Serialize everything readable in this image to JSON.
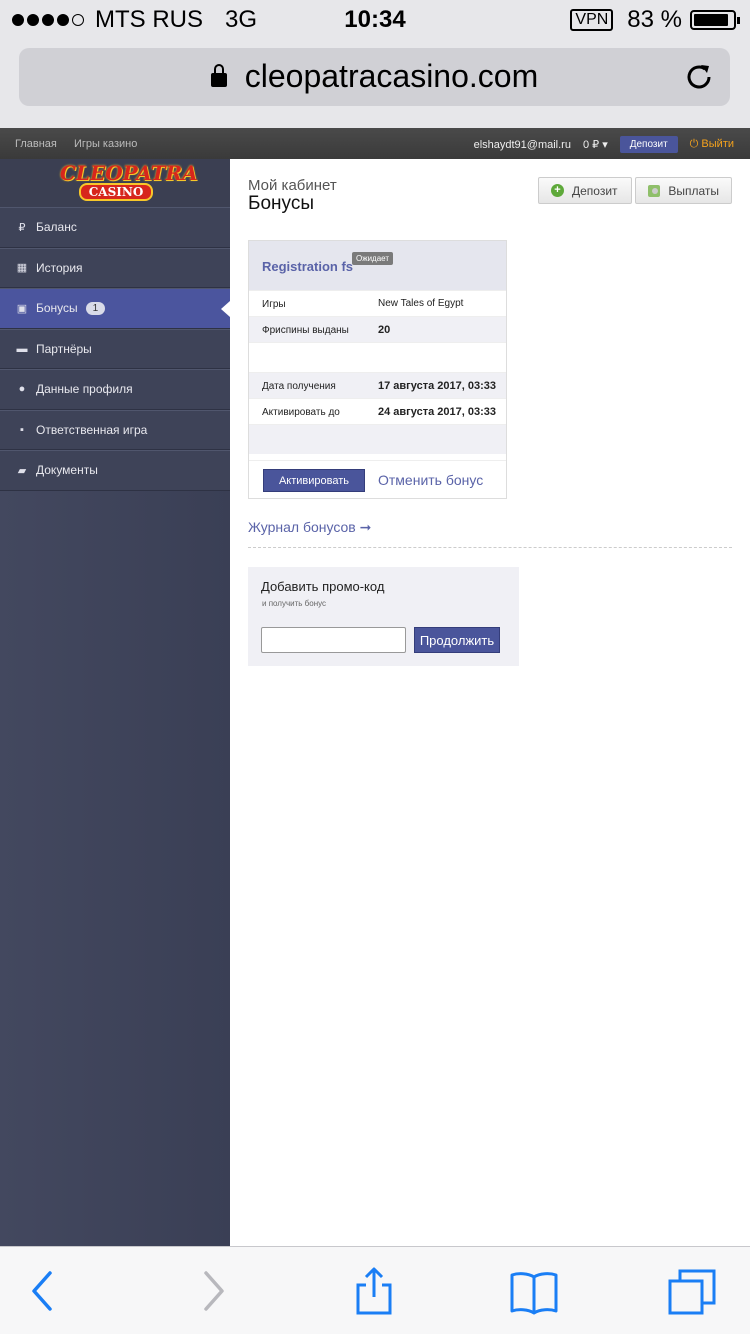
{
  "status_bar": {
    "carrier": "MTS RUS",
    "network": "3G",
    "time": "10:34",
    "vpn": "VPN",
    "battery": "83 %"
  },
  "browser": {
    "url": "cleopatracasino.com",
    "icons": [
      "lock-icon",
      "reload-icon",
      "back-icon",
      "forward-icon",
      "share-icon",
      "bookmarks-icon",
      "tabs-icon"
    ]
  },
  "topbar": {
    "nav": [
      "Главная",
      "Игры казино"
    ],
    "email": "elshaydt91@mail.ru",
    "balance": "0 ₽ ▾",
    "deposit": "Депозит",
    "exit": "⏻ Выйти"
  },
  "logo": {
    "line1": "CLEOPATRA",
    "line2": "CASINO"
  },
  "sidebar": {
    "items": [
      {
        "label": "Баланс",
        "icon": "ruble-icon",
        "glyph": "₽"
      },
      {
        "label": "История",
        "icon": "calendar-icon",
        "glyph": "▦"
      },
      {
        "label": "Бонусы",
        "icon": "gift-icon",
        "glyph": "▣",
        "badge": "1"
      },
      {
        "label": "Партнёры",
        "icon": "briefcase-icon",
        "glyph": "▬"
      },
      {
        "label": "Данные профиля",
        "icon": "info-icon",
        "glyph": "●"
      },
      {
        "label": "Ответственная игра",
        "icon": "lock-icon",
        "glyph": "▪"
      },
      {
        "label": "Документы",
        "icon": "folder-icon",
        "glyph": "▰"
      }
    ]
  },
  "main": {
    "breadcrumb": "Мой кабинет",
    "title": "Бонусы",
    "deposit_button": "Депозит",
    "payouts_button": "Выплаты",
    "bonus": {
      "title": "Registration fs",
      "status": "Ожидает",
      "rows": [
        {
          "key": "Игры",
          "value": "New Tales of Egypt"
        },
        {
          "key": "Фриспины выданы",
          "value": "20"
        },
        {
          "key": "Дата получения",
          "value": "17 августа 2017, 03:33"
        },
        {
          "key": "Активировать до",
          "value": "24 августа 2017, 03:33"
        }
      ],
      "activate": "Активировать",
      "cancel": "Отменить бонус"
    },
    "journal_link": "Журнал бонусов ➞",
    "promo": {
      "title": "Добавить промо-код",
      "subtitle": "и получить бонус",
      "input_value": "",
      "submit": "Продолжить"
    }
  },
  "colors": {
    "accent": "#4a559b",
    "link": "#5a63a8",
    "sidebar": "#3e4358",
    "exit": "#f4a21d"
  }
}
